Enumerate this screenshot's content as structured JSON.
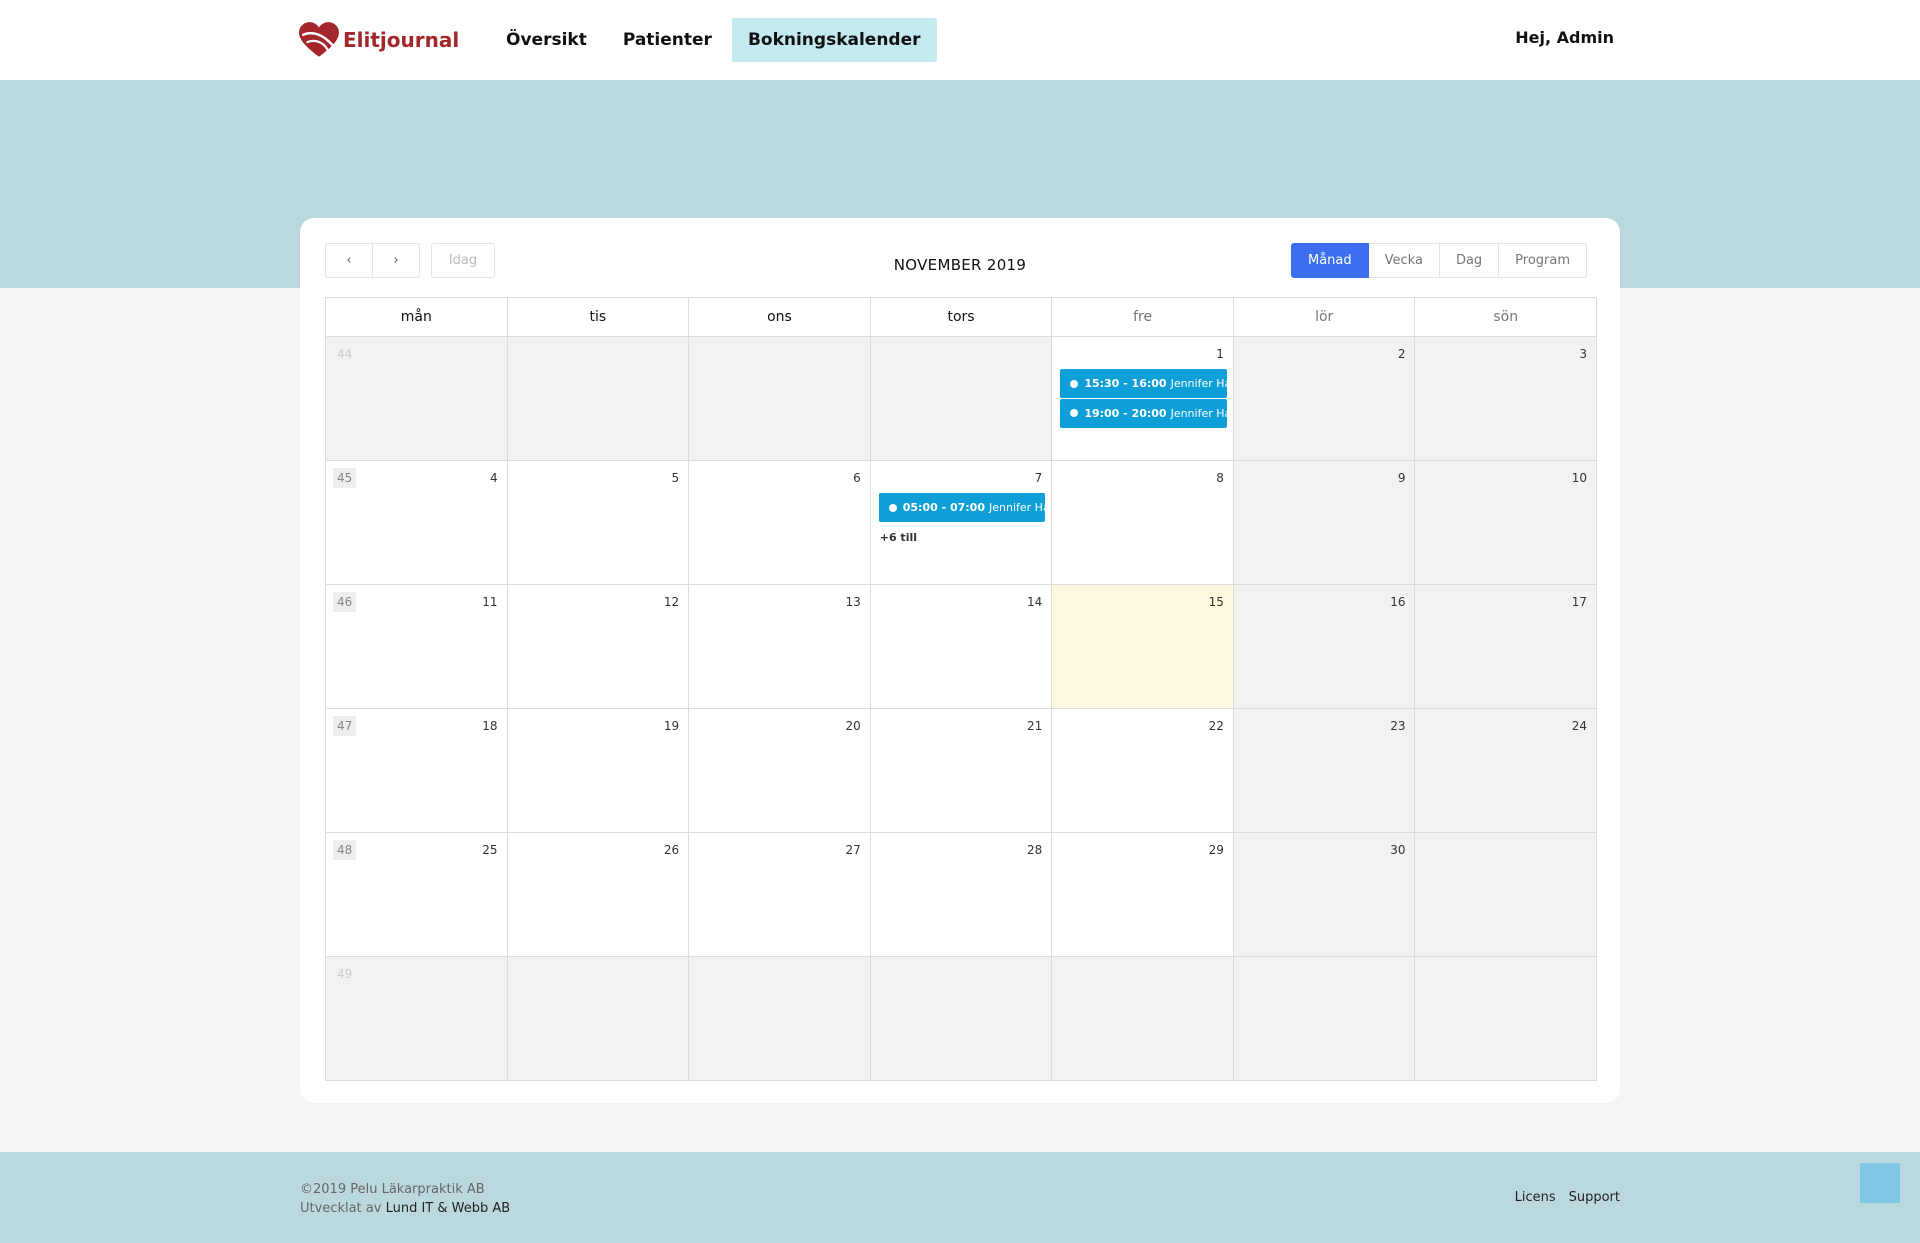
{
  "app": {
    "name": "Elitjournal",
    "brand_color": "#a3262a"
  },
  "nav": {
    "items": [
      {
        "label": "Översikt",
        "active": false
      },
      {
        "label": "Patienter",
        "active": false
      },
      {
        "label": "Bokningskalender",
        "active": true
      }
    ]
  },
  "user": {
    "greeting": "Hej,  Admin"
  },
  "calendar": {
    "title": "NOVEMBER 2019",
    "prev_icon": "‹",
    "next_icon": "›",
    "today_label": "Idag",
    "views": [
      "Månad",
      "Vecka",
      "Dag",
      "Program"
    ],
    "active_view": "Månad",
    "weekdays": [
      "mån",
      "tis",
      "ons",
      "tors",
      "fre",
      "lör",
      "sön"
    ],
    "weeks": [
      {
        "week": "44",
        "days": [
          "",
          "",
          "",
          "",
          "1",
          "2",
          "3"
        ]
      },
      {
        "week": "45",
        "days": [
          "4",
          "5",
          "6",
          "7",
          "8",
          "9",
          "10"
        ]
      },
      {
        "week": "46",
        "days": [
          "11",
          "12",
          "13",
          "14",
          "15",
          "16",
          "17"
        ]
      },
      {
        "week": "47",
        "days": [
          "18",
          "19",
          "20",
          "21",
          "22",
          "23",
          "24"
        ]
      },
      {
        "week": "48",
        "days": [
          "25",
          "26",
          "27",
          "28",
          "29",
          "30",
          ""
        ]
      },
      {
        "week": "49",
        "days": [
          "",
          "",
          "",
          "",
          "",
          "",
          ""
        ]
      }
    ],
    "events": {
      "1": [
        {
          "time": "15:30 - 16:00",
          "title": "Jennifer Hay"
        },
        {
          "time": "19:00 - 20:00",
          "title": "Jennifer Hay"
        }
      ],
      "7": [
        {
          "time": "05:00 - 07:00",
          "title": "Jennifer Ha"
        }
      ]
    },
    "more": {
      "7": "+6 till"
    },
    "today_date": "15",
    "accent_color": "#3c6ff0",
    "event_color": "#0e9fd9",
    "today_color": "#fef8e0"
  },
  "footer": {
    "copyright": "©2019 Pelu Läkarpraktik AB",
    "developed_prefix": "Utvecklat av ",
    "developer": "Lund IT & Webb AB",
    "links": [
      "Licens",
      "Support"
    ]
  }
}
